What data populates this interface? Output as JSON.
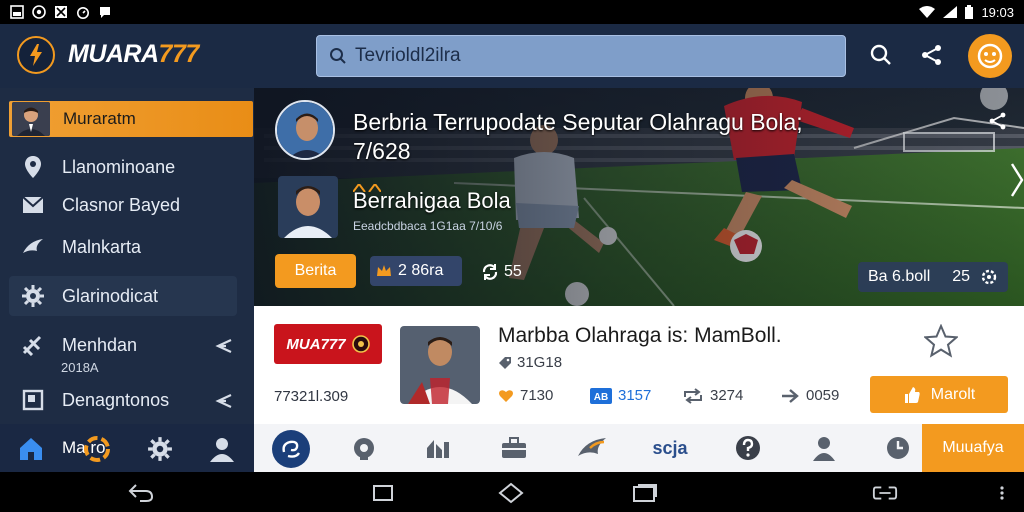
{
  "status_bar": {
    "time": "19:03"
  },
  "header": {
    "brand_main": "MUARA",
    "brand_accent": "777",
    "search_placeholder": "Tevrioldl2ilra"
  },
  "sidebar": {
    "active_item": "Muraratm",
    "items": [
      {
        "label": "Llanominoane",
        "icon": "location-pin-icon"
      },
      {
        "label": "Clasnor Bayed",
        "icon": "mail-icon"
      },
      {
        "label": "Malnkarta",
        "icon": "bird-icon"
      },
      {
        "label": "Glarinodicat",
        "icon": "gear-icon"
      },
      {
        "label": "Menhdan",
        "icon": "slash-tools-icon",
        "sub": "2018A"
      },
      {
        "label": "Denagntonos",
        "icon": "frame-icon"
      }
    ],
    "bottom_label": "Ma  ro"
  },
  "hero": {
    "title": "Berbria Terrupodate Seputar Olahragu Bola; 7/628",
    "subtitle": "Berrahigaa Bola",
    "meta": "Eeadcbdbaca 1G1aa  7/10/6",
    "tag_label": "Berita",
    "views": "2 86ra",
    "shares": "55",
    "right_label": "Ba 6.boll",
    "right_count": "25"
  },
  "card": {
    "logo_text": "MUA777",
    "id_text": "77321l.309",
    "title": "Marbba Olahraga is: MamBoll.",
    "count": "31G18",
    "stats": [
      {
        "icon": "heart-icon",
        "value": "7130",
        "color": "#f39a1f"
      },
      {
        "icon": "ab-badge-icon",
        "value": "3157",
        "color": "#1e6fd9"
      },
      {
        "icon": "repeat-icon",
        "value": "3274",
        "color": "#59616d"
      },
      {
        "icon": "arrow-icon",
        "value": "0059",
        "color": "#59616d"
      }
    ],
    "action_label": "Marolt"
  },
  "bottom_nav": {
    "text_item": "scja",
    "cta": "Muuafya"
  },
  "colors": {
    "brand_orange": "#f39a1f",
    "navy": "#1b2a44",
    "sidebar": "#1e2c44"
  }
}
